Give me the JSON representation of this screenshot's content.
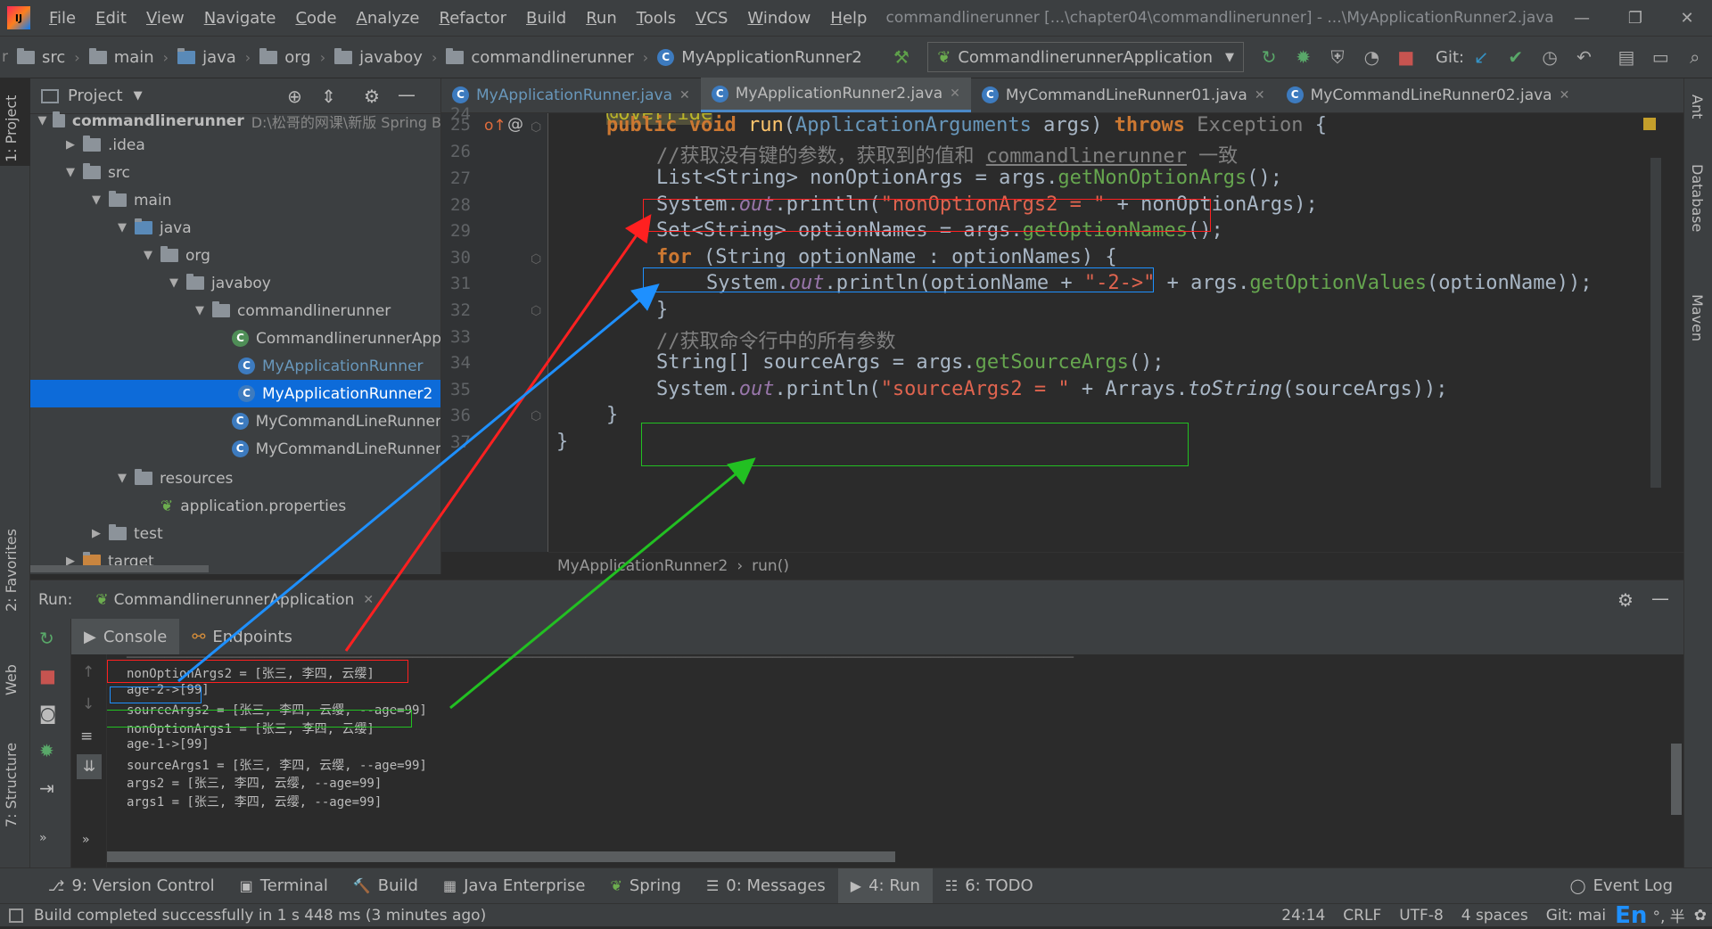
{
  "menubar": {
    "logo": "IJ",
    "items": [
      "File",
      "Edit",
      "View",
      "Navigate",
      "Code",
      "Analyze",
      "Refactor",
      "Build",
      "Run",
      "Tools",
      "VCS",
      "Window",
      "Help"
    ],
    "title": "commandlinerunner [...\\chapter04\\commandlinerunner] - ...\\MyApplicationRunner2.java"
  },
  "navbar": {
    "crumbs": [
      "src",
      "main",
      "java",
      "org",
      "javaboy",
      "commandlinerunner"
    ],
    "file": "MyApplicationRunner2",
    "run_config": "CommandlinerunnerApplication",
    "git_label": "Git:"
  },
  "project": {
    "header": "Project",
    "tree": [
      {
        "label": "commandlinerunner",
        "extra": "D:\\松哥的网课\\新版 Spring B",
        "indent": 0,
        "arrow": "▼",
        "icon": "folder",
        "bold": true
      },
      {
        "label": ".idea",
        "indent": 1,
        "arrow": "▶",
        "icon": "folder"
      },
      {
        "label": "src",
        "indent": 1,
        "arrow": "▼",
        "icon": "folder"
      },
      {
        "label": "main",
        "indent": 2,
        "arrow": "▼",
        "icon": "folder"
      },
      {
        "label": "java",
        "indent": 3,
        "arrow": "▼",
        "icon": "folder-blue"
      },
      {
        "label": "org",
        "indent": 4,
        "arrow": "▼",
        "icon": "pkg"
      },
      {
        "label": "javaboy",
        "indent": 5,
        "arrow": "▼",
        "icon": "pkg"
      },
      {
        "label": "commandlinerunner",
        "indent": 6,
        "arrow": "▼",
        "icon": "pkg"
      },
      {
        "label": "CommandlinerunnerApp",
        "indent": 7,
        "arrow": "",
        "icon": "spring-class"
      },
      {
        "label": "MyApplicationRunner",
        "indent": 7,
        "arrow": "",
        "icon": "class",
        "color": "#6897bb"
      },
      {
        "label": "MyApplicationRunner2",
        "indent": 7,
        "arrow": "",
        "icon": "class",
        "selected": true
      },
      {
        "label": "MyCommandLineRunner",
        "indent": 7,
        "arrow": "",
        "icon": "class"
      },
      {
        "label": "MyCommandLineRunner",
        "indent": 7,
        "arrow": "",
        "icon": "class"
      },
      {
        "label": "resources",
        "indent": 3,
        "arrow": "▼",
        "icon": "folder"
      },
      {
        "label": "application.properties",
        "indent": 4,
        "arrow": "",
        "icon": "props"
      },
      {
        "label": "test",
        "indent": 2,
        "arrow": "▶",
        "icon": "folder"
      },
      {
        "label": "target",
        "indent": 1,
        "arrow": "▶",
        "icon": "folder-orange"
      }
    ]
  },
  "editor": {
    "tabs": [
      {
        "label": "MyApplicationRunner.java",
        "active": false,
        "color": "#6897bb"
      },
      {
        "label": "MyApplicationRunner2.java",
        "active": true,
        "color": "#bbbbbb"
      },
      {
        "label": "MyCommandLineRunner01.java",
        "active": false,
        "color": "#bbbbbb"
      },
      {
        "label": "MyCommandLineRunner02.java",
        "active": false,
        "color": "#bbbbbb"
      }
    ],
    "line_numbers": [
      "24",
      "25",
      "26",
      "27",
      "28",
      "29",
      "30",
      "31",
      "32",
      "33",
      "34",
      "35",
      "36",
      "37"
    ],
    "breadcrumb": [
      "MyApplicationRunner2",
      "run()"
    ]
  },
  "run": {
    "label": "Run:",
    "config": "CommandlinerunnerApplication",
    "tabs": [
      "Console",
      "Endpoints"
    ],
    "console": [
      "nonOptionArgs2 = [张三, 李四, 云缨]",
      "age-2->[99]",
      "sourceArgs2 = [张三, 李四, 云缨, --age=99]",
      "nonOptionArgs1 = [张三, 李四, 云缨]",
      "age-1->[99]",
      "sourceArgs1 = [张三, 李四, 云缨, --age=99]",
      "args2 = [张三, 李四, 云缨, --age=99]",
      "args1 = [张三, 李四, 云缨, --age=99]"
    ]
  },
  "side": {
    "left": [
      "1: Project",
      "2: Favorites",
      "Web",
      "7: Structure"
    ],
    "right": [
      "Ant",
      "Database",
      "Maven"
    ]
  },
  "tool_windows": [
    {
      "icon": "⎇",
      "label": "9: Version Control"
    },
    {
      "icon": "▣",
      "label": "Terminal"
    },
    {
      "icon": "🔨",
      "label": "Build"
    },
    {
      "icon": "▦",
      "label": "Java Enterprise"
    },
    {
      "icon": "❦",
      "label": "Spring"
    },
    {
      "icon": "☰",
      "label": "0: Messages"
    },
    {
      "icon": "▶",
      "label": "4: Run"
    },
    {
      "icon": "☷",
      "label": "6: TODO"
    }
  ],
  "event_log": "Event Log",
  "status": {
    "message": "Build completed successfully in 1 s 448 ms (3 minutes ago)",
    "position": "24:14",
    "line_sep": "CRLF",
    "encoding": "UTF-8",
    "indent": "4 spaces",
    "git": "Git: mai",
    "ime": "En",
    "ime_extra": "°, 半"
  },
  "colors": {
    "red": "#ff2020",
    "blue": "#1e90ff",
    "green": "#22c022",
    "selection": "#0d6bd9"
  }
}
